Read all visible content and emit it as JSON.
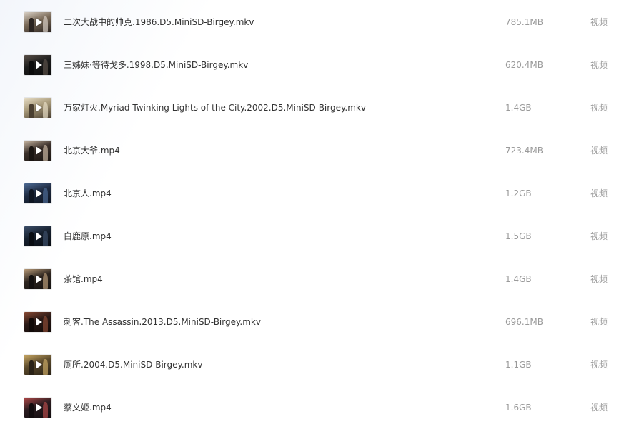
{
  "files": [
    {
      "name": "二次大战中的帅克.1986.D5.MiniSD-Birgey.mkv",
      "size": "785.1MB",
      "type": "视频",
      "thumb": {
        "bg": "#7a6a58",
        "fg": "#d8cfc4",
        "accent": "#2b2420"
      }
    },
    {
      "name": "三姊妹·等待戈多.1998.D5.MiniSD-Birgey.mkv",
      "size": "620.4MB",
      "type": "视频",
      "thumb": {
        "bg": "#1c1c1c",
        "fg": "#5a5048",
        "accent": "#0b0b0b"
      }
    },
    {
      "name": "万家灯火.Myriad Twinking Lights of the City.2002.D5.MiniSD-Birgey.mkv",
      "size": "1.4GB",
      "type": "视频",
      "thumb": {
        "bg": "#a89a7a",
        "fg": "#e7ddc5",
        "accent": "#4a3f31"
      }
    },
    {
      "name": "北京大爷.mp4",
      "size": "723.4MB",
      "type": "视频",
      "thumb": {
        "bg": "#3a2f2a",
        "fg": "#c9b7a3",
        "accent": "#1a1512"
      }
    },
    {
      "name": "北京人.mp4",
      "size": "1.2GB",
      "type": "视频",
      "thumb": {
        "bg": "#1e2a40",
        "fg": "#4c6a94",
        "accent": "#0e1522"
      }
    },
    {
      "name": "白鹿原.mp4",
      "size": "1.5GB",
      "type": "视频",
      "thumb": {
        "bg": "#16202e",
        "fg": "#3c4e6a",
        "accent": "#080c12"
      }
    },
    {
      "name": "茶馆.mp4",
      "size": "1.4GB",
      "type": "视频",
      "thumb": {
        "bg": "#2e2620",
        "fg": "#b79a78",
        "accent": "#141110"
      }
    },
    {
      "name": "刺客.The Assassin.2013.D5.MiniSD-Birgey.mkv",
      "size": "696.1MB",
      "type": "视频",
      "thumb": {
        "bg": "#2a1a16",
        "fg": "#8a4a34",
        "accent": "#120a08"
      }
    },
    {
      "name": "厕所.2004.D5.MiniSD-Birgey.mkv",
      "size": "1.1GB",
      "type": "视频",
      "thumb": {
        "bg": "#5b4a2c",
        "fg": "#c9a864",
        "accent": "#2a2216"
      }
    },
    {
      "name": "蔡文姬.mp4",
      "size": "1.6GB",
      "type": "视频",
      "thumb": {
        "bg": "#2a1c20",
        "fg": "#b04848",
        "accent": "#120c0e"
      }
    }
  ]
}
